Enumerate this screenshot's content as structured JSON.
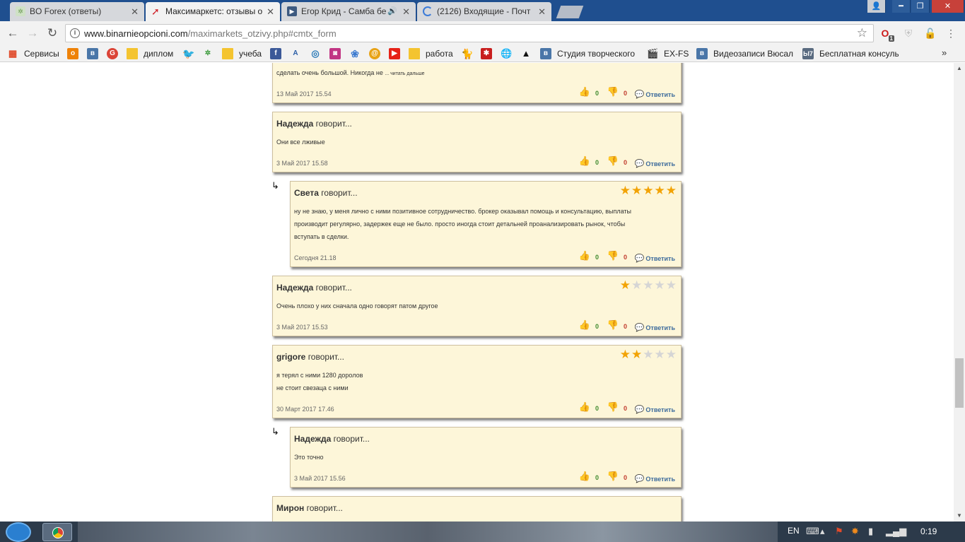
{
  "browser": {
    "tabs": [
      {
        "label": "BO Forex (ответы)",
        "icon": "bo-forex-icon"
      },
      {
        "label": "Максимаркетс: отзывы о",
        "icon": "maximarkets-icon"
      },
      {
        "label": "Егор Крид - Самба бе",
        "icon": "video-icon"
      },
      {
        "label": "(2126) Входящие - Почт",
        "icon": "loading-icon"
      }
    ],
    "url_host": "www.binarnieopcioni.com",
    "url_path": "/maximarkets_otzivy.php#cmtx_form",
    "ext_badge": "1"
  },
  "bookmarks": {
    "services": "Сервисы",
    "diplom": "диплом",
    "ucheba": "учеба",
    "rabota": "работа",
    "studio": "Студия творческого",
    "exfs": "EX-FS",
    "video": "Видеозаписи Вюсал",
    "consult_badge": "Ы7",
    "consult": "Бесплатная консульт"
  },
  "comments": [
    {
      "body": "сделать очень большой. Никогда не",
      "more": "... читать дальше",
      "date": "13 Май 2017 15.54",
      "likes": "0",
      "dislikes": "0"
    },
    {
      "author": "Надежда",
      "says": "говорит...",
      "body": "Они все лживые",
      "date": "3 Май 2017 15.58",
      "likes": "0",
      "dislikes": "0"
    },
    {
      "author": "Света",
      "says": "говорит...",
      "rating": 5,
      "body_lines": [
        "ну не знаю, у меня лично с ними позитивное сотрудничество. брокер оказывал помощь и консультацию, выплаты",
        "производит регулярно, задержек еще не было. просто иногда стоит детальней проанализировать рынок, чтобы",
        "вступать в сделки."
      ],
      "date": "Сегодня 21.18",
      "likes": "0",
      "dislikes": "0"
    },
    {
      "author": "Надежда",
      "says": "говорит...",
      "rating": 1,
      "body": "Очень плохо у них сначала одно говорят патом другое",
      "date": "3 Май 2017 15.53",
      "likes": "0",
      "dislikes": "0"
    },
    {
      "author": "grigore",
      "says": "говорит...",
      "rating": 2,
      "body_lines": [
        "я терял с ними 1280 доролов",
        "не стоит свезаца с ними"
      ],
      "date": "30 Март 2017 17.46",
      "likes": "0",
      "dislikes": "0"
    },
    {
      "author": "Надежда",
      "says": "говорит...",
      "body": "Это точно",
      "date": "3 Май 2017 15.56",
      "likes": "0",
      "dislikes": "0"
    },
    {
      "author": "Мирон",
      "says": "говорит..."
    }
  ],
  "reply_label": "Ответить",
  "taskbar": {
    "lang": "EN",
    "clock": "0:19"
  }
}
